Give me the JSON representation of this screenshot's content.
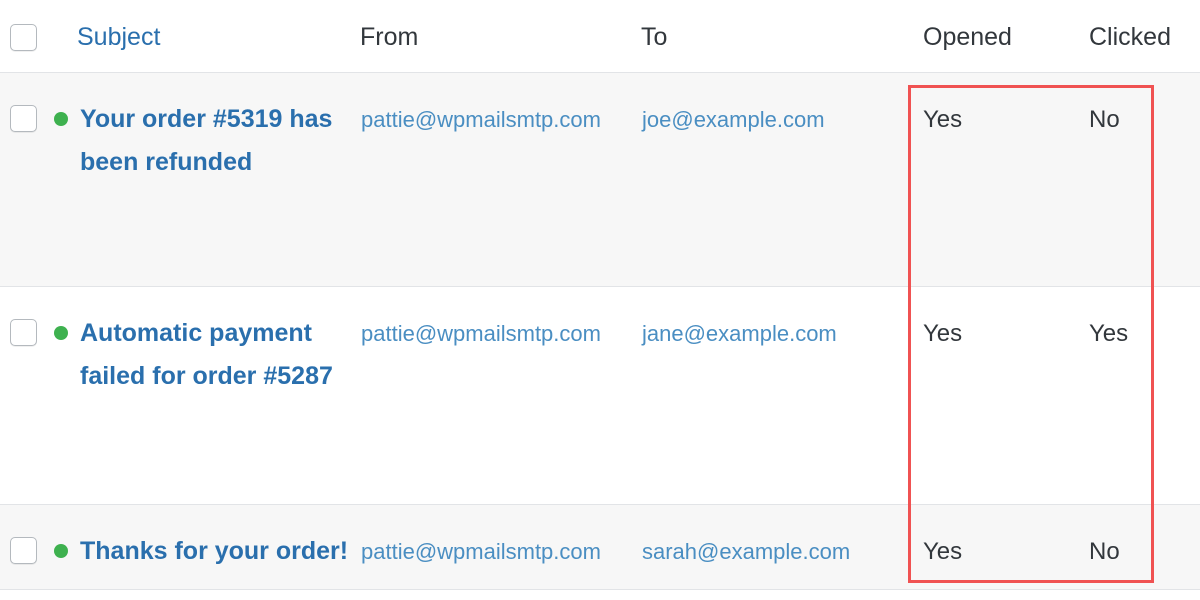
{
  "table": {
    "header": {
      "select_all_checkbox": "select-all",
      "columns": [
        {
          "key": "subject",
          "label": "Subject",
          "is_link": true
        },
        {
          "key": "from",
          "label": "From",
          "is_link": false
        },
        {
          "key": "to",
          "label": "To",
          "is_link": false
        },
        {
          "key": "opened",
          "label": "Opened",
          "is_link": false
        },
        {
          "key": "clicked",
          "label": "Clicked",
          "is_link": false
        }
      ]
    },
    "rows": [
      {
        "status": "green",
        "subject": "Your order #5319 has been refunded",
        "from": "pattie@wpmailsmtp.com",
        "to": "joe@example.com",
        "opened": "Yes",
        "clicked": "No"
      },
      {
        "status": "green",
        "subject": "Automatic payment failed for order #5287",
        "from": "pattie@wpmailsmtp.com",
        "to": "jane@example.com",
        "opened": "Yes",
        "clicked": "Yes"
      },
      {
        "status": "green",
        "subject": "Thanks for your order!",
        "from": "pattie@wpmailsmtp.com",
        "to": "sarah@example.com",
        "opened": "Yes",
        "clicked": "No"
      }
    ]
  },
  "annotation": {
    "type": "rectangle-highlight",
    "color": "#f05252",
    "covers_columns": "Opened, Clicked"
  },
  "colors": {
    "link": "#2a6fad",
    "email_link": "#4a8ec2",
    "text": "#32373c",
    "status_dot": "#3eb14f",
    "row_alt_background": "#f7f7f7",
    "row_background": "#ffffff",
    "row_separator": "#e2e4e7",
    "highlight": "#f05252",
    "checkbox_border": "#b4b9be"
  }
}
